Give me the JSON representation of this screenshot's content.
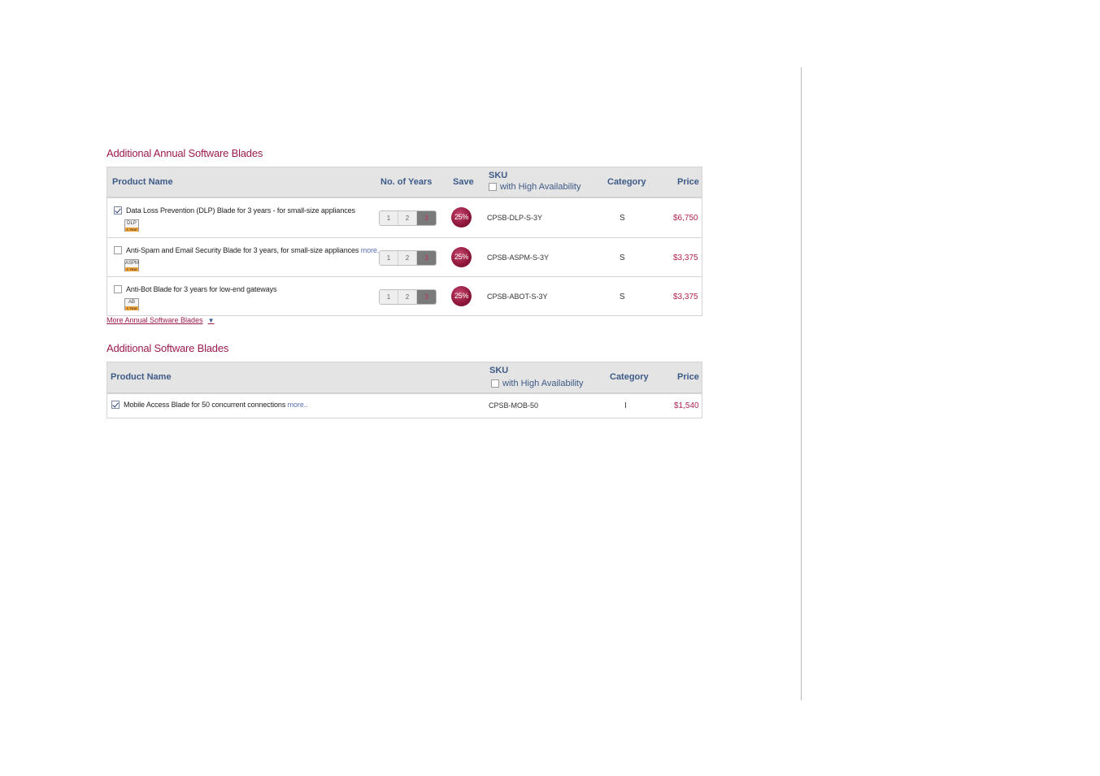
{
  "annual": {
    "title": "Additional Annual Software Blades",
    "headers": {
      "product": "Product Name",
      "years": "No. of Years",
      "save": "Save",
      "sku": "SKU",
      "ha": "with High Availability",
      "category": "Category",
      "price": "Price"
    },
    "rows": [
      {
        "checked": true,
        "name": "Data Loss Prevention (DLP) Blade for 3 years - for small-size appliances",
        "more": "",
        "badge": "DLP",
        "badge_year": "1 Year",
        "years": [
          "1",
          "2",
          "3"
        ],
        "selected_year": "3",
        "save": "25%",
        "sku": "CPSB-DLP-S-3Y",
        "category": "S",
        "price": "$6,750"
      },
      {
        "checked": false,
        "name": "Anti-Spam and Email Security Blade for 3 years, for small-size appliances",
        "more": "more..",
        "badge": "ASPM",
        "badge_year": "1 Year",
        "years": [
          "1",
          "2",
          "3"
        ],
        "selected_year": "3",
        "save": "25%",
        "sku": "CPSB-ASPM-S-3Y",
        "category": "S",
        "price": "$3,375"
      },
      {
        "checked": false,
        "name": "Anti-Bot Blade for 3 years for low-end gateways",
        "more": "",
        "badge": "AB",
        "badge_year": "1 Year",
        "years": [
          "1",
          "2",
          "3"
        ],
        "selected_year": "3",
        "save": "25%",
        "sku": "CPSB-ABOT-S-3Y",
        "category": "S",
        "price": "$3,375"
      }
    ],
    "more_link": "More Annual Software Blades"
  },
  "software": {
    "title": "Additional Software Blades",
    "headers": {
      "product": "Product Name",
      "sku": "SKU",
      "ha": "with High Availability",
      "category": "Category",
      "price": "Price"
    },
    "rows": [
      {
        "checked": true,
        "name": "Mobile Access Blade for 50 concurrent connections",
        "more": "more..",
        "sku": "CPSB-MOB-50",
        "category": "I",
        "price": "$1,540"
      }
    ]
  },
  "colors": {
    "accent": "#9b1b4b",
    "header_text": "#3e5a87",
    "price": "#b0244f"
  }
}
